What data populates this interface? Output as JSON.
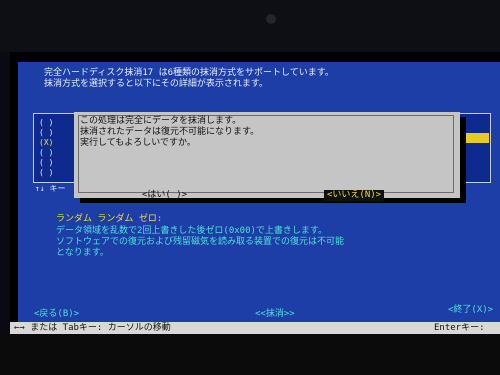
{
  "header": {
    "line1": "完全ハードディスク抹消17 は6種類の抹消方式をサポートしています。",
    "line2": "抹消方式を選択すると以下にその詳細が表示されます。"
  },
  "method_list": {
    "items": [
      {
        "label": "( )"
      },
      {
        "label": "( )"
      },
      {
        "label": "(X)"
      },
      {
        "label": "( )"
      },
      {
        "label": "( )"
      },
      {
        "label": "( )"
      }
    ],
    "scroll_hint": "↑↓ キー"
  },
  "dialog": {
    "line1": "この処理は完全にデータを抹消します。",
    "line2": "抹消されたデータは復元不可能になります。",
    "line3": "実行してもよろしいですか。",
    "yes_label": "<はい( )>",
    "no_label": "<いいえ(N)>"
  },
  "details": {
    "method_name": "ランダム  ランダム  ゼロ:",
    "line1": "データ領域を乱数で2回上書きした後ゼロ(0x00)で上書きします。",
    "line2": "ソフトウェアでの復元および残留磁気を読み取る装置での復元は不可能",
    "line3": "となります。"
  },
  "nav": {
    "back": "<戻る(B)>",
    "erase": "<<抹消>>",
    "finish": "<終了(X)>"
  },
  "status": {
    "left": "←→ または Tabキー: カーソルの移動",
    "right": "Enterキー:"
  },
  "colors": {
    "panel": "#1d3ea7",
    "dialog": "#c5c5c5",
    "highlight": "#e8c928",
    "accent_text": "#f0dd3a",
    "detail_text": "#4fe0d8"
  }
}
